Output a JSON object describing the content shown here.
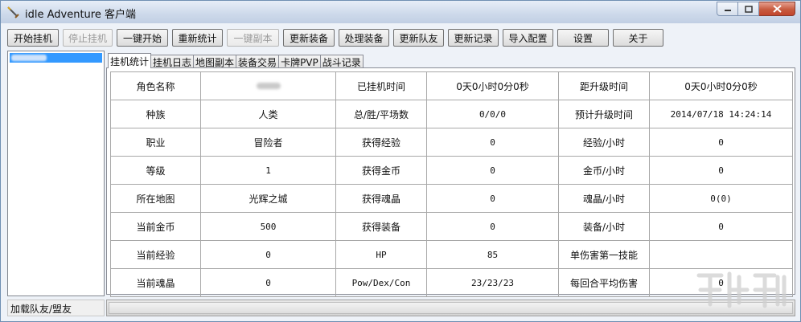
{
  "window": {
    "title": "idle Adventure 客户端"
  },
  "toolbar": [
    {
      "label": "开始挂机",
      "name": "start-idle-button",
      "enabled": true
    },
    {
      "label": "停止挂机",
      "name": "stop-idle-button",
      "enabled": false
    },
    {
      "label": "一键开始",
      "name": "one-click-start-button",
      "enabled": true
    },
    {
      "label": "重新统计",
      "name": "reset-stats-button",
      "enabled": true
    },
    {
      "label": "一键副本",
      "name": "one-click-dungeon-button",
      "enabled": false
    },
    {
      "label": "更新装备",
      "name": "update-equipment-button",
      "enabled": true
    },
    {
      "label": "处理装备",
      "name": "process-equipment-button",
      "enabled": true
    },
    {
      "label": "更新队友",
      "name": "update-teammates-button",
      "enabled": true
    },
    {
      "label": "更新记录",
      "name": "update-records-button",
      "enabled": true
    },
    {
      "label": "导入配置",
      "name": "import-config-button",
      "enabled": true
    },
    {
      "label": "设置",
      "name": "settings-button",
      "enabled": true
    },
    {
      "label": "关于",
      "name": "about-button",
      "enabled": true
    }
  ],
  "tabs": [
    {
      "label": "挂机统计",
      "active": true
    },
    {
      "label": "挂机日志",
      "active": false
    },
    {
      "label": "地图副本",
      "active": false
    },
    {
      "label": "装备交易",
      "active": false
    },
    {
      "label": "卡牌PVP",
      "active": false
    },
    {
      "label": "战斗记录",
      "active": false
    }
  ],
  "stats": {
    "rows": [
      [
        "角色名称",
        "",
        "已挂机时间",
        "0天0小时0分0秒",
        "距升级时间",
        "0天0小时0分0秒"
      ],
      [
        "种族",
        "人类",
        "总/胜/平场数",
        "0/0/0",
        "预计升级时间",
        "2014/07/18 14:24:14"
      ],
      [
        "职业",
        "冒险者",
        "获得经验",
        "0",
        "经验/小时",
        "0"
      ],
      [
        "等级",
        "1",
        "获得金币",
        "0",
        "金币/小时",
        "0"
      ],
      [
        "所在地图",
        "光辉之城",
        "获得魂晶",
        "0",
        "魂晶/小时",
        "0(0)"
      ],
      [
        "当前金币",
        "500",
        "获得装备",
        "0",
        "装备/小时",
        "0"
      ],
      [
        "当前经验",
        "0",
        "HP",
        "85",
        "单伤害第一技能",
        ""
      ],
      [
        "当前魂晶",
        "0",
        "Pow/Dex/Con",
        "23/23/23",
        "每回合平均伤害",
        "0"
      ]
    ]
  },
  "status": {
    "left_label": "加载队友/盟友",
    "progress": 0
  },
  "colors": {
    "selection": "#3399ff",
    "progress_fill": "#06b025",
    "close_button": "#c75b3f"
  }
}
